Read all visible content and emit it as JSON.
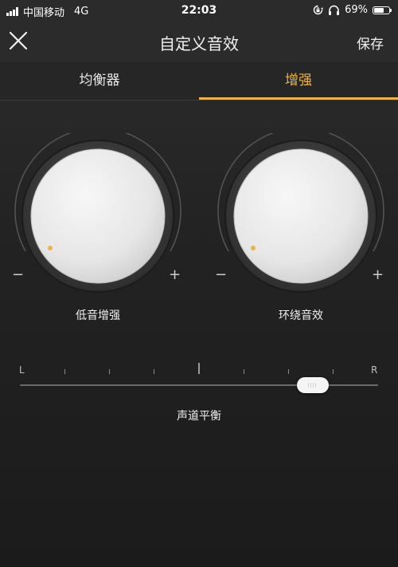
{
  "status_bar": {
    "carrier": "中国移动",
    "network": "4G",
    "time": "22:03",
    "battery": "69%",
    "battery_level": 0.69
  },
  "nav": {
    "title": "自定义音效",
    "close_icon": "close-icon",
    "save_label": "保存"
  },
  "tabs": [
    {
      "label": "均衡器",
      "active": false
    },
    {
      "label": "增强",
      "active": true
    }
  ],
  "colors": {
    "accent": "#e9b44c",
    "background": "#232323",
    "text": "#eaeaea"
  },
  "knobs": [
    {
      "label": "低音增强",
      "minus": "−",
      "plus": "+"
    },
    {
      "label": "环绕音效",
      "minus": "−",
      "plus": "+"
    }
  ],
  "balance": {
    "left_label": "L",
    "right_label": "R",
    "title": "声道平衡"
  }
}
